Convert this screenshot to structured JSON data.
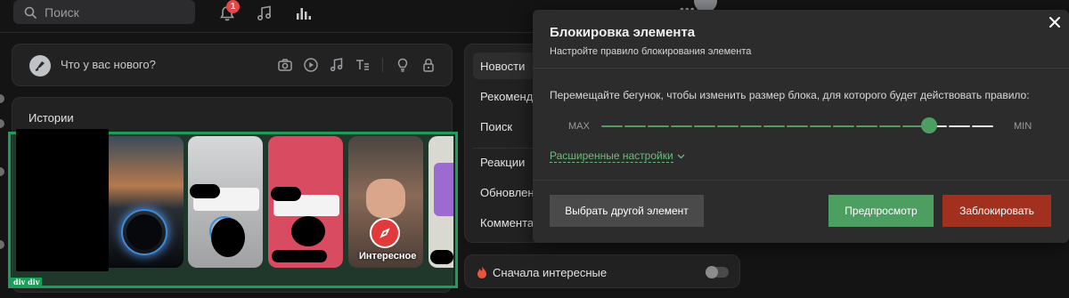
{
  "topbar": {
    "search_placeholder": "Поиск",
    "notification_count": "1",
    "more_dots": "•••"
  },
  "composer": {
    "placeholder": "Что у вас нового?"
  },
  "stories": {
    "title": "Истории",
    "featured_label": "Интересное",
    "highlight_tag": "div div"
  },
  "feed_nav": {
    "items": [
      {
        "label": "Новости"
      },
      {
        "label": "Рекомендации"
      },
      {
        "label": "Поиск"
      },
      {
        "label": "Реакции"
      },
      {
        "label": "Обновления"
      },
      {
        "label": "Комментарии"
      }
    ],
    "interesting_first": "Сначала интересные"
  },
  "modal": {
    "title": "Блокировка элемента",
    "subtitle": "Настройте правило блокирования элемента",
    "instruction": "Перемещайте бегунок, чтобы изменить размер блока, для которого будет действовать правило:",
    "slider": {
      "min_label": "MIN",
      "max_label": "MAX",
      "position_fraction": 0.82
    },
    "advanced_link": "Расширенные настройки",
    "buttons": {
      "choose_other": "Выбрать другой элемент",
      "preview": "Предпросмотр",
      "block": "Заблокировать"
    }
  },
  "colors": {
    "accent_green": "#4d9e61",
    "block_red": "#a2301f",
    "highlight_green": "#1d9d5b",
    "badge_red": "#e64646"
  }
}
